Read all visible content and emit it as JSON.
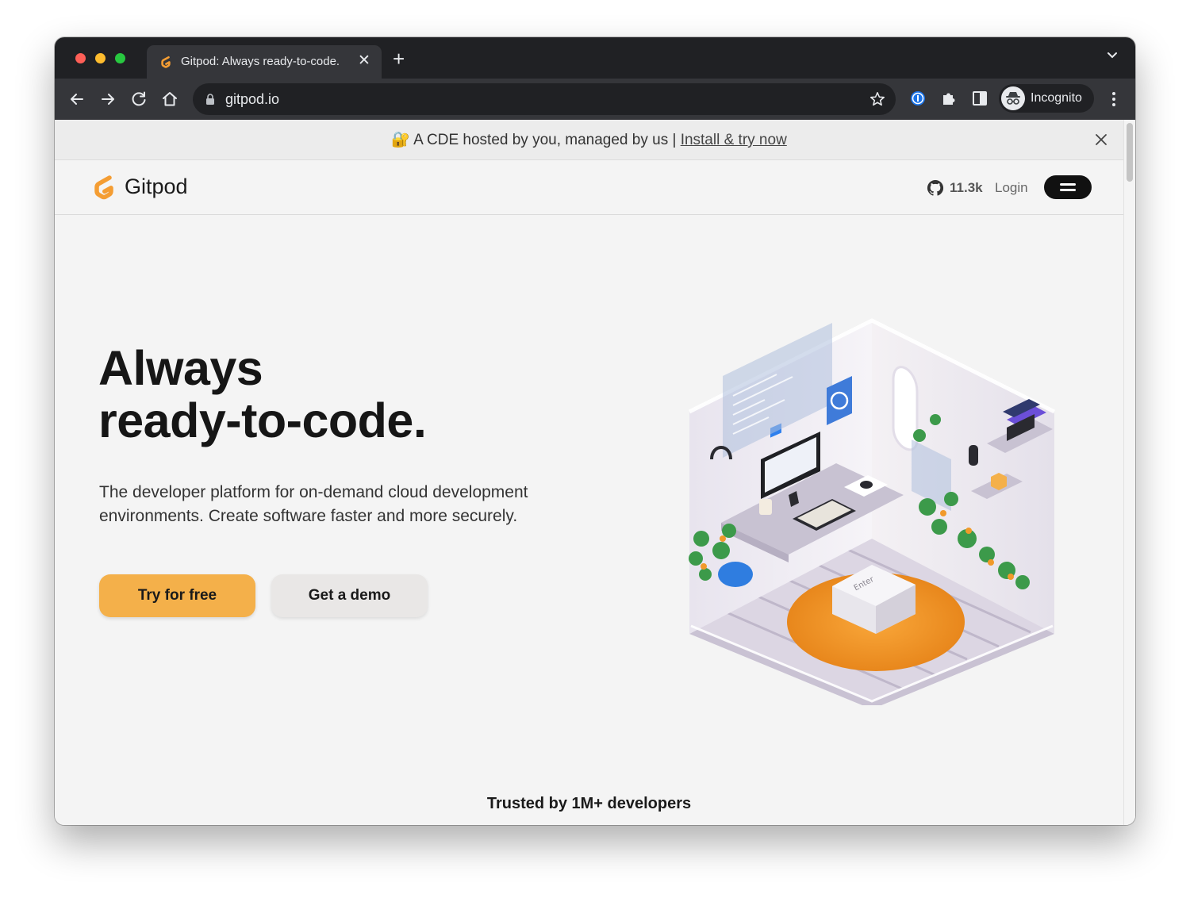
{
  "browser": {
    "tab": {
      "title": "Gitpod: Always ready-to-code."
    },
    "url": "gitpod.io",
    "profile_label": "Incognito"
  },
  "banner": {
    "emoji": "🔐",
    "text": "A CDE hosted by you, managed by us | ",
    "link": "Install & try now"
  },
  "nav": {
    "logo": "Gitpod",
    "github_stars": "11.3k",
    "login": "Login"
  },
  "hero": {
    "title_line1": "Always",
    "title_line2": "ready-to-code.",
    "subtitle": "The developer platform for on-demand cloud development environments. Create software faster and more securely.",
    "cta_primary": "Try for free",
    "cta_secondary": "Get a demo"
  },
  "illustration": {
    "key_label": "Enter"
  },
  "footer_teaser": "Trusted by 1M+ developers",
  "colors": {
    "accent": "#f4b04a",
    "logo_orange": "#f49d33",
    "chrome_dark": "#202124",
    "chrome_mid": "#35363a"
  }
}
